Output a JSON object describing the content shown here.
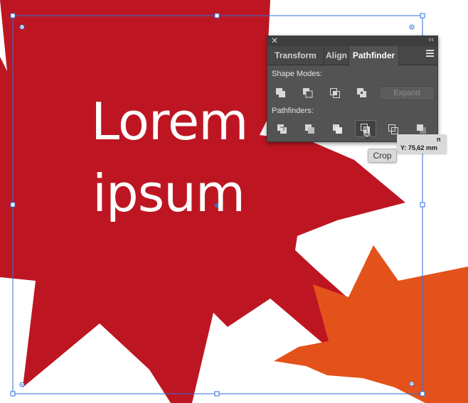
{
  "canvas": {
    "text_line1": "Lorem",
    "text_line2": "ipsum",
    "colors": {
      "red_star": "#bd1622",
      "orange_star": "#e4521b",
      "selection": "#2f6fd8"
    }
  },
  "panel": {
    "close_glyph": "✕",
    "collapse_glyph": "‹‹",
    "tabs": [
      {
        "label": "Transform",
        "active": false
      },
      {
        "label": "Align",
        "active": false
      },
      {
        "label": "Pathfinder",
        "active": true
      }
    ],
    "menu_icon": "hamburger-menu-icon",
    "shape_modes_label": "Shape Modes:",
    "shape_modes_icons": [
      "unite-icon",
      "minus-front-icon",
      "intersect-icon",
      "exclude-icon"
    ],
    "expand_label": "Expand",
    "pathfinders_label": "Pathfinders:",
    "pathfinder_icons": [
      "divide-icon",
      "trim-icon",
      "merge-icon",
      "crop-icon",
      "outline-icon",
      "minus-back-icon"
    ],
    "hovered_button": "crop-icon"
  },
  "tooltips": {
    "crop": "Crop",
    "coord_x_suffix": "n",
    "coord_y": "Y: 75,62 mm"
  }
}
